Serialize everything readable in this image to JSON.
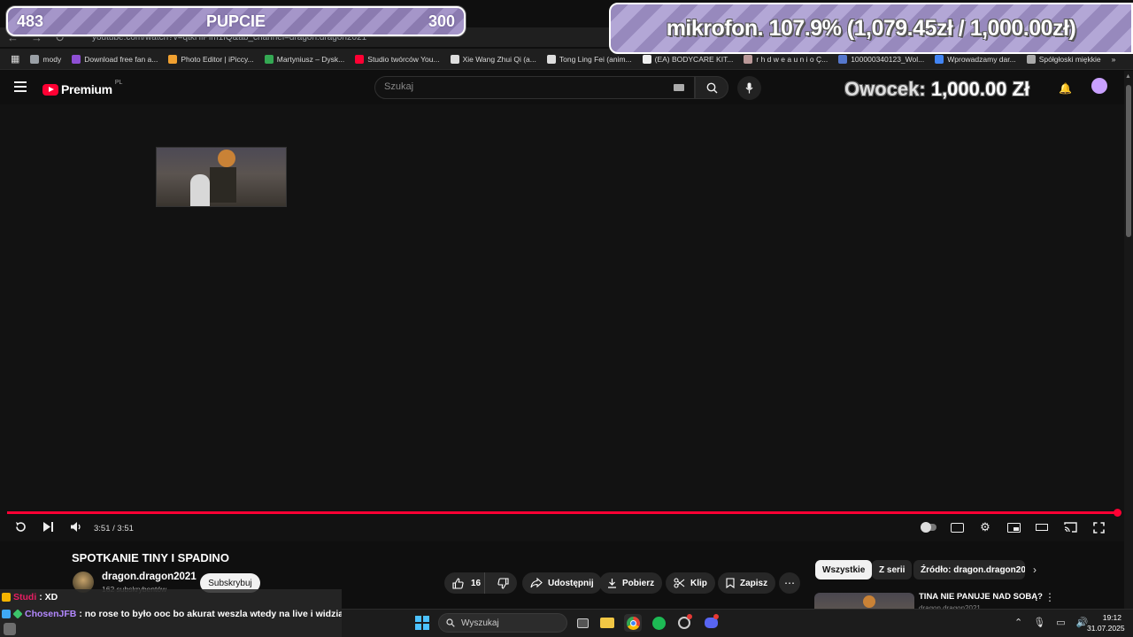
{
  "browser": {
    "url": "youtube.com/watch?v=qtkHiPlm1fQ&ab_channel=dragon.dragon2021",
    "bookmarks": [
      {
        "label": "mody",
        "color": "#9aa0a6"
      },
      {
        "label": "Download free fan a...",
        "color": "#8e4fd4"
      },
      {
        "label": "Photo Editor | iPiccy...",
        "color": "#f0a030"
      },
      {
        "label": "Martyniusz – Dysk...",
        "color": "#34a853"
      },
      {
        "label": "Studio twórców You...",
        "color": "#ff0033"
      },
      {
        "label": "Xie Wang Zhui Qi (a...",
        "color": "#dddddd"
      },
      {
        "label": "Tong Ling Fei (anim...",
        "color": "#dddddd"
      },
      {
        "label": "(EA) BODYCARE KIT...",
        "color": "#eeeeee"
      },
      {
        "label": "r h d w e a u n i o Ç...",
        "color": "#bb9999"
      },
      {
        "label": "100000340123_Wol...",
        "color": "#5577cc"
      },
      {
        "label": "Wprowadzamy dar...",
        "color": "#4285f4"
      },
      {
        "label": "Spółgłoski miękkie",
        "color": "#aaaaaa"
      }
    ]
  },
  "youtube": {
    "logo_text": "Premium",
    "logo_region": "PL",
    "search_placeholder": "Szukaj"
  },
  "overlays": {
    "counter_left": "483",
    "counter_title": "PUPCIE",
    "counter_right": "300",
    "mikrofon_text": "mikrofon. 107.9% (1,079.45zł / 1,000.00zł)",
    "mikrofon_progress_percent": 107.9,
    "owocek_label": "Owocek:",
    "owocek_value": "1,000.00 Zł"
  },
  "player": {
    "current_time": "3:51 / 3:51",
    "progress_fraction": 1.0,
    "accent_color": "#ff0033"
  },
  "video": {
    "title": "SPOTKANIE TINY I SPADINO",
    "channel": "dragon.dragon2021",
    "subscribers": "162 subskrybentów",
    "subscribe_label": "Subskrybuj",
    "likes": "16",
    "share_label": "Udostępnij",
    "download_label": "Pobierz",
    "clip_label": "Klip",
    "save_label": "Zapisz"
  },
  "related": {
    "chips": [
      "Wszystkie",
      "Z serii",
      "Źródło: dragon.dragon2021"
    ],
    "first_title": "TINA NIE PANUJE NAD SOBĄ?",
    "first_channel": "dragon.dragon2021"
  },
  "chat": [
    {
      "user": "Studi",
      "message": ": XD",
      "user_color": "#e91e63"
    },
    {
      "user": "ChosenJFB",
      "message": ": no rose to było ooc bo akurat weszla wtedy na live i widziala",
      "user_color": "#b388ff"
    }
  ],
  "taskbar": {
    "search_placeholder": "Wyszukaj",
    "time": "19:12",
    "date": "31.07.2025"
  }
}
